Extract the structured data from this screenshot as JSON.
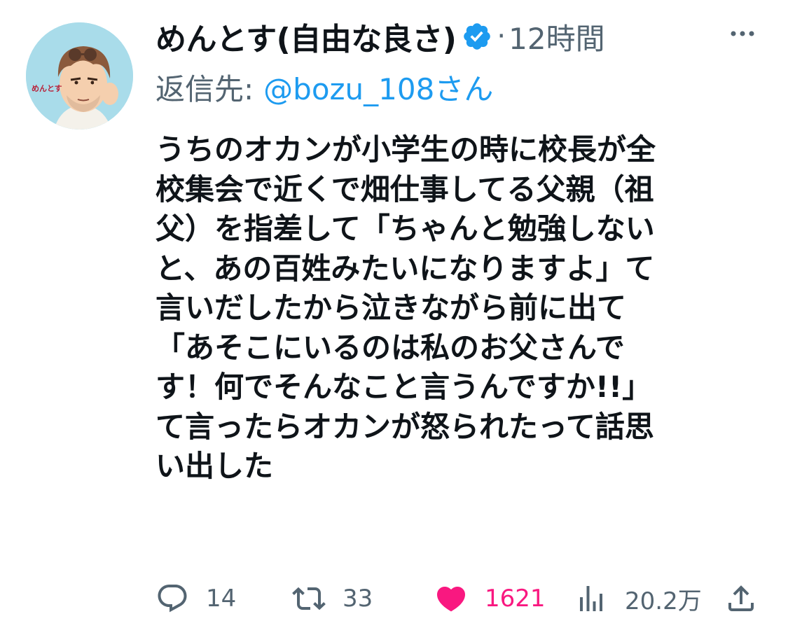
{
  "tweet": {
    "display_name": "めんとす(自由な良さ)",
    "separator": "·",
    "time_ago": "12時間",
    "reply_prefix": "返信先:",
    "reply_handle": "@bozu_108さん",
    "avatar_text": "めんとす",
    "text_lines": [
      "うちのオカンが小学生の時に校長が全",
      "校集会で近くで畑仕事してる父親（祖",
      "父）を指差して「ちゃんと勉強しない",
      "と、あの百姓みたいになりますよ」て",
      "言いだしたから泣きながら前に出て",
      "「あそこにいるのは私のお父さんで",
      "す！何でそんなこと言うんですか!!」",
      "て言ったらオカンが怒られたって話思",
      "い出した"
    ]
  },
  "actions": {
    "reply": {
      "icon": "reply-icon",
      "count": "14"
    },
    "retweet": {
      "icon": "retweet-icon",
      "count": "33"
    },
    "like": {
      "icon": "heart-filled-icon",
      "count": "1621",
      "liked": true
    },
    "views": {
      "icon": "views-chart-icon",
      "count": "20.2万"
    },
    "share": {
      "icon": "share-icon"
    }
  },
  "colors": {
    "accent_blue": "#1d9bf0",
    "like_pink": "#f91880",
    "secondary_text": "#536471",
    "primary_text": "#0f1419",
    "avatar_bg": "#a9dcea"
  }
}
